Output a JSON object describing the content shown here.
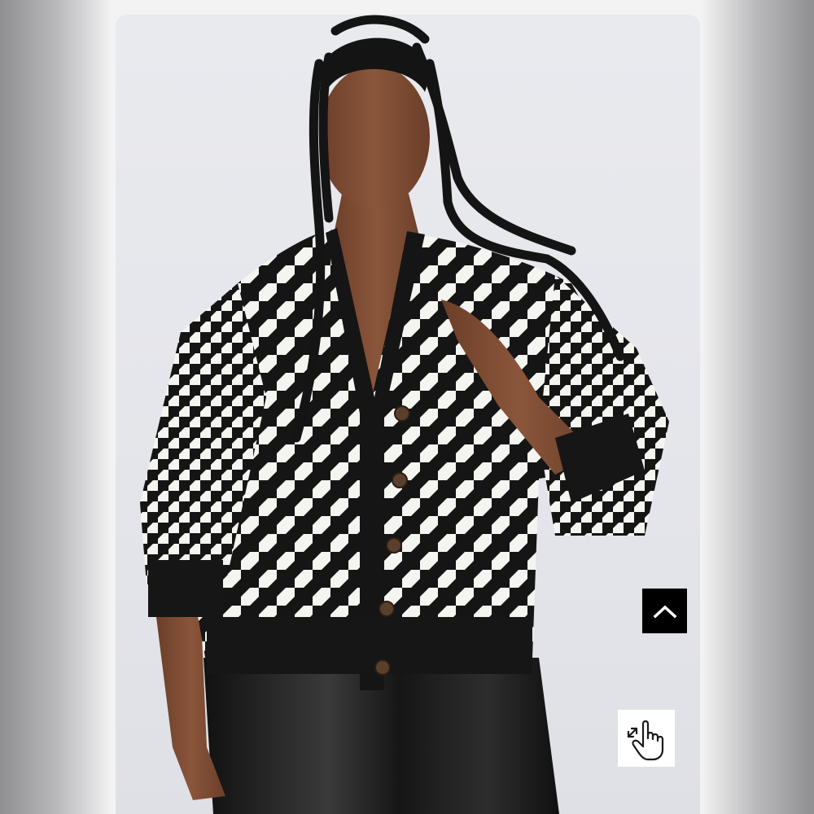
{
  "product_image": {
    "alt_subject": "houndstooth-cardigan-model",
    "pattern": "houndstooth",
    "colors": {
      "knit_black": "#151515",
      "knit_white": "#f4f4f0",
      "skin": "#7a4a32",
      "leggings": "#1c1c1c",
      "button": "#5a3f2c",
      "backdrop": "#e6e7eb"
    }
  },
  "controls": {
    "back_to_top": {
      "icon": "chevron-up-icon",
      "bg": "#000000"
    },
    "zoom": {
      "icon": "pinch-zoom-hand-icon",
      "bg": "#ffffff"
    }
  }
}
